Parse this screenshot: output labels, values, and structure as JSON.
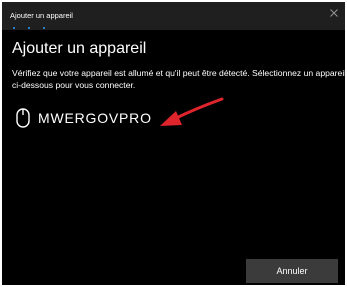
{
  "window": {
    "title": "Ajouter un appareil",
    "accent_color": "#2b9aff",
    "close_icon": "close-icon"
  },
  "main": {
    "heading": "Ajouter un appareil",
    "description": "Vérifiez que votre appareil est allumé et qu'il peut être détecté. Sélectionnez un appareil ci-dessous pour vous connecter."
  },
  "devices": [
    {
      "icon": "mouse-icon",
      "name": "MWERGOVPRO"
    }
  ],
  "annotation": {
    "arrow_color": "#e0242c",
    "arrow_icon": "red-arrow-icon"
  },
  "footer": {
    "cancel_label": "Annuler"
  }
}
